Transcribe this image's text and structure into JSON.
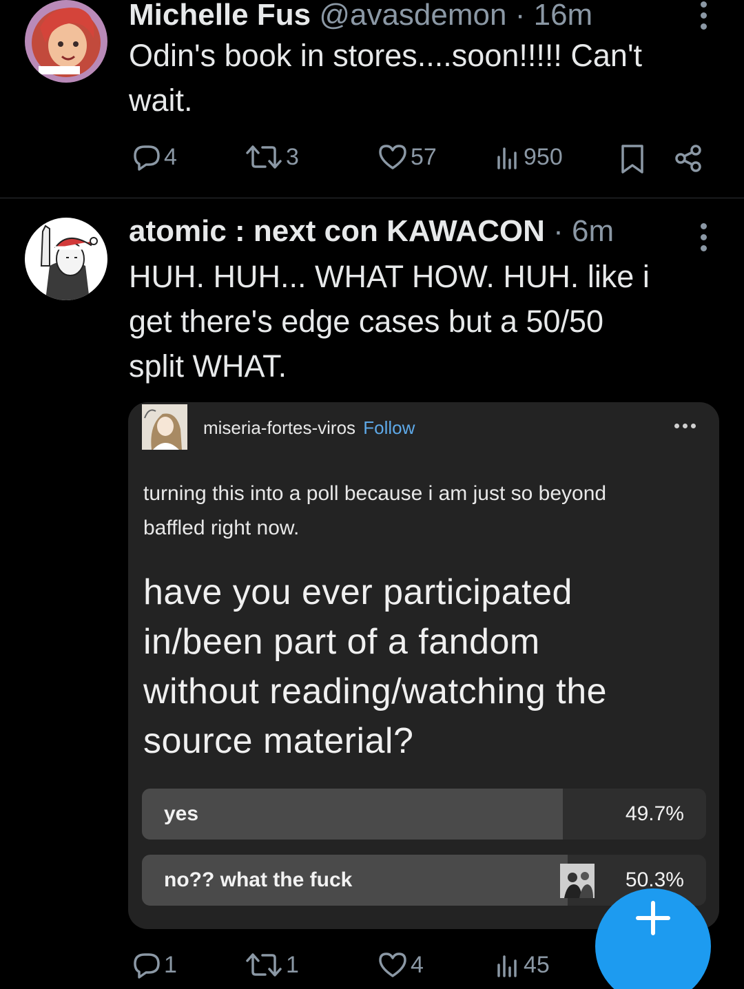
{
  "tweets": [
    {
      "display_name": "Michelle Fus",
      "handle": "@avasdemon",
      "separator": "·",
      "time": "16m",
      "text_lines": [
        "Odin's book in stores....soon!!!!! Can't",
        "wait."
      ],
      "replies": "4",
      "retweets": "3",
      "likes": "57",
      "views": "950"
    },
    {
      "display_name": "atomic : next con KAWACON",
      "separator": "·",
      "time": "6m",
      "text_lines": [
        "HUH. HUH... WHAT HOW. HUH. like i",
        "get there's edge cases but a 50/50",
        "split WHAT."
      ],
      "replies": "1",
      "retweets": "1",
      "likes": "4",
      "views": "45"
    }
  ],
  "embed": {
    "username": "miseria-fortes-viros",
    "follow_label": "Follow",
    "body_lines": [
      "turning this into a poll because i am just so beyond",
      "baffled right now."
    ],
    "question_lines": [
      "have you ever participated",
      "in/been part of a fandom",
      "without reading/watching the",
      "source material?"
    ],
    "poll": [
      {
        "label": "yes",
        "percent_text": "49.7%",
        "fraction": 0.497
      },
      {
        "label": "no?? what the fuck",
        "percent_text": "50.3%",
        "fraction": 0.503
      }
    ]
  },
  "icons": {
    "reply": "reply-icon",
    "retweet": "retweet-icon",
    "like": "heart-icon",
    "views": "views-icon",
    "bookmark": "bookmark-icon",
    "share": "share-icon",
    "compose": "plus-icon"
  },
  "colors": {
    "background": "#000000",
    "muted": "#8b98a5",
    "accent": "#1d9bf0",
    "tumblr_link": "#5ea9e8",
    "card_bg": "#232323"
  }
}
